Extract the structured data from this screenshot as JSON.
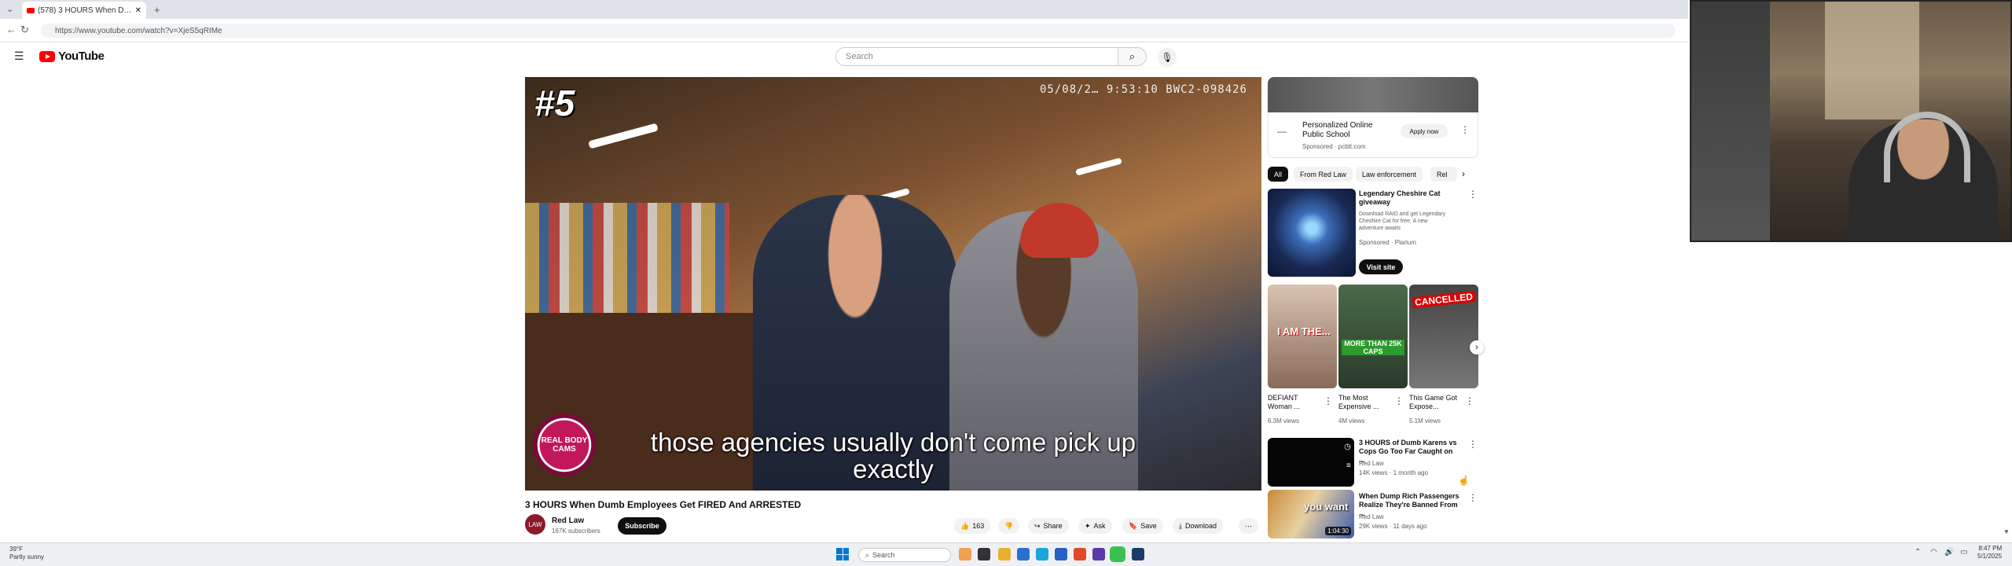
{
  "browser": {
    "tab_title": "(578) 3 HOURS When Dumb E...",
    "url": "https://www.youtube.com/watch?v=XjeS5qRIMe"
  },
  "header": {
    "logo_text": "YouTube",
    "search_placeholder": "Search"
  },
  "player": {
    "overlay_number": "#5",
    "timestamp": "05/08/2… 9:53:10  BWC2-098426",
    "caption_line1": "those agencies usually don't come pick up",
    "caption_line2": "exactly",
    "channel_logo_text": "REAL BODY CAMS"
  },
  "video": {
    "title": "3 HOURS When Dumb Employees Get FIRED And ARRESTED",
    "channel": "Red Law",
    "subscribers": "167K subscribers",
    "avatar_text": "LAW",
    "subscribe_label": "Subscribe",
    "actions": {
      "likes": "163",
      "share": "Share",
      "ask": "Ask",
      "save": "Save",
      "download": "Download"
    }
  },
  "sidebar": {
    "ad": {
      "title": "Personalized Online Public School",
      "sponsor": "Sponsored · pcbtt.com",
      "apply": "Apply now"
    },
    "chips": [
      "All",
      "From Red Law",
      "Law enforcement",
      "Rel"
    ],
    "ad2": {
      "title": "Legendary Cheshire Cat giveaway",
      "desc": "Download RAID and get Legendary Cheshire Cat for free. A new adventure awaits",
      "sponsor": "Sponsored · Plarium",
      "cta": "Visit site"
    },
    "shorts": [
      {
        "title": "DEFIANT Woman ...",
        "views": "6.3M views",
        "thumb_text": "I AM THE..."
      },
      {
        "title": "The Most Expensive ...",
        "views": "4M views",
        "thumb_text": "MORE THAN 25K CAPS"
      },
      {
        "title": "This Game Got Expose...",
        "views": "5.1M views",
        "thumb_text": "CANCELLED"
      }
    ],
    "videos": [
      {
        "title": "3 HOURS of Dumb Karens vs Cops Go Too Far Caught on ...",
        "channel": "Red Law",
        "meta": "14K views · 1 month ago"
      },
      {
        "title": "When Dump Rich Passengers Realize They're Banned From ...",
        "channel": "Red Law",
        "meta": "29K views · 11 days ago",
        "duration": "1:04:30",
        "thumb_text": "you want"
      }
    ]
  },
  "taskbar": {
    "weather_temp": "39°F",
    "weather_desc": "Partly sunny",
    "search": "Search",
    "time": "8:47 PM",
    "date": "5/1/2025"
  },
  "colors": {
    "brand_red": "#ff0000",
    "text_primary": "#0f0f0f",
    "chip_bg": "#f2f2f2"
  }
}
